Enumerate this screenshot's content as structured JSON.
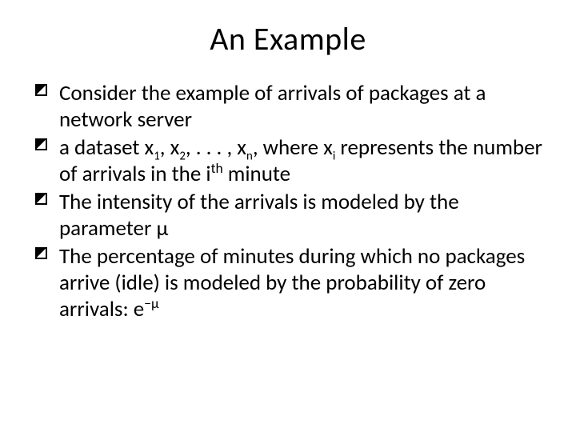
{
  "title": "An Example",
  "bullets": [
    {
      "parts": [
        {
          "t": "Consider the example of arrivals of packages at a network server"
        }
      ]
    },
    {
      "parts": [
        {
          "t": "a dataset x"
        },
        {
          "t": "1",
          "cls": "ssub"
        },
        {
          "t": ", x"
        },
        {
          "t": "2",
          "cls": "ssub"
        },
        {
          "t": ", . . . , x"
        },
        {
          "t": "n",
          "cls": "ssub"
        },
        {
          "t": ", where x"
        },
        {
          "t": "i",
          "cls": "ssub"
        },
        {
          "t": " represents the number of arrivals in the i"
        },
        {
          "t": "th",
          "cls": "ssup"
        },
        {
          "t": " minute"
        }
      ]
    },
    {
      "parts": [
        {
          "t": "The intensity of the arrivals is modeled by the parameter μ"
        }
      ]
    },
    {
      "parts": [
        {
          "t": "The percentage of minutes during which no packages arrive (idle) is modeled by the probability of zero arrivals: e"
        },
        {
          "t": "−μ",
          "cls": "ssup"
        }
      ]
    }
  ]
}
